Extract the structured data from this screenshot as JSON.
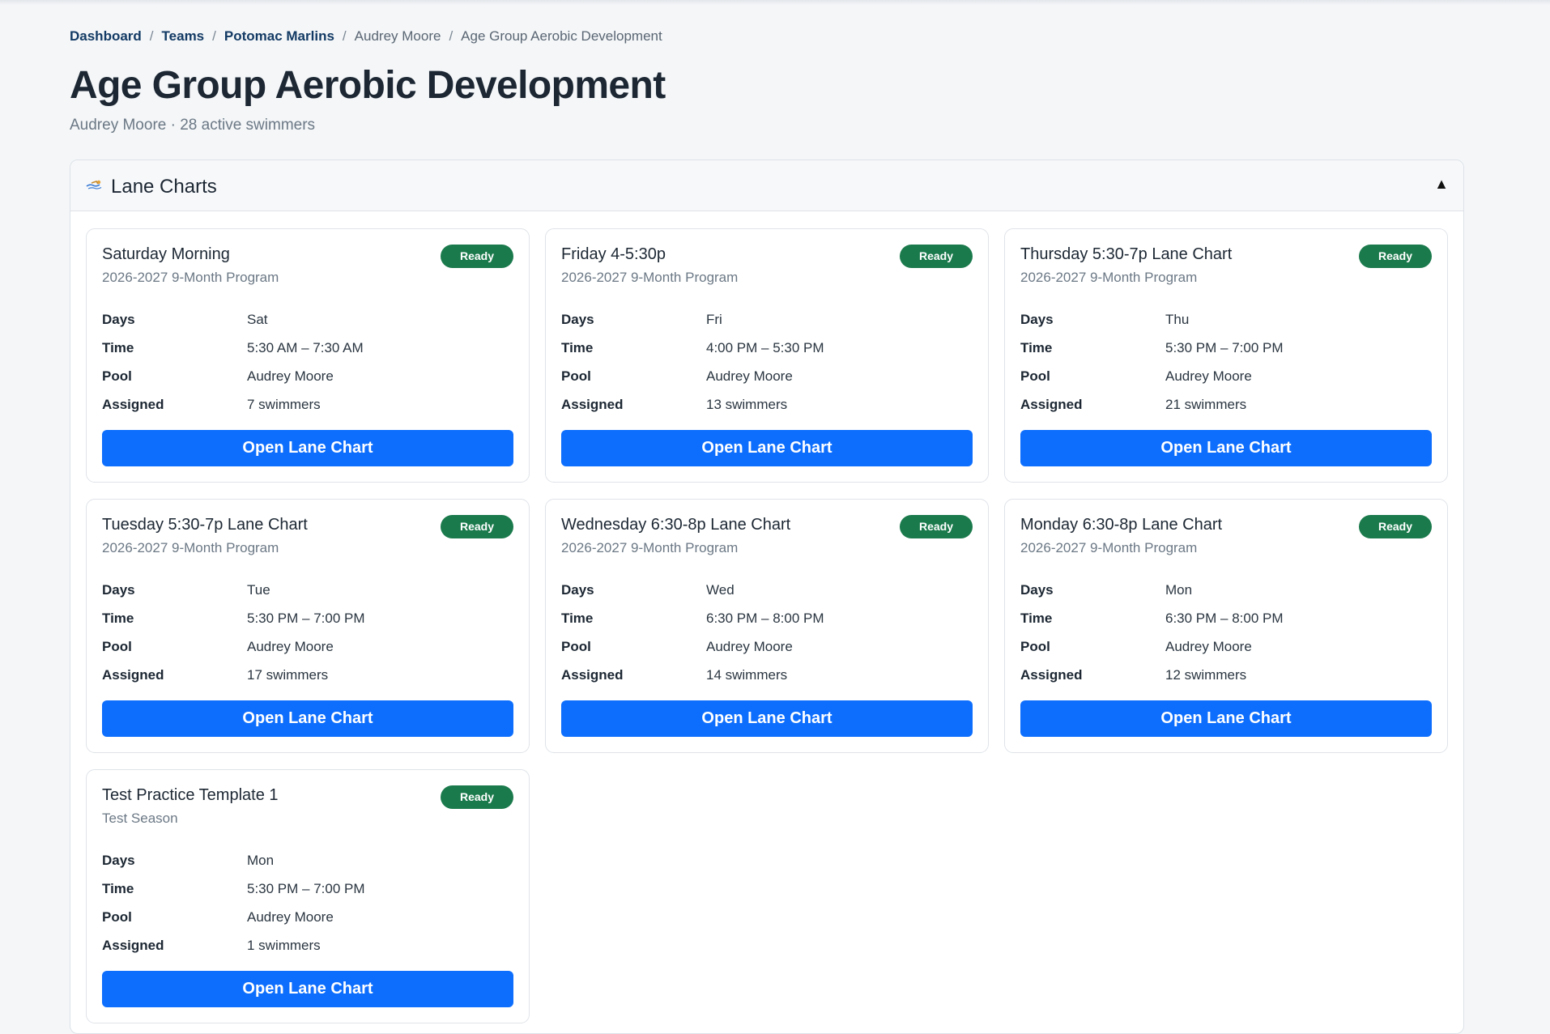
{
  "breadcrumb": {
    "items": [
      "Dashboard",
      "Teams",
      "Potomac Marlins",
      "Audrey Moore",
      "Age Group Aerobic Development"
    ],
    "separator": "/"
  },
  "page": {
    "title": "Age Group Aerobic Development",
    "subtitle": "Audrey Moore · 28 active swimmers"
  },
  "panel": {
    "title": "Lane Charts",
    "toggle": "▲"
  },
  "labels": {
    "days": "Days",
    "time": "Time",
    "pool": "Pool",
    "assigned": "Assigned",
    "button": "Open Lane Chart"
  },
  "cards": [
    {
      "title": "Saturday Morning",
      "season": "2026-2027 9-Month Program",
      "status": "Ready",
      "days": "Sat",
      "time": "5:30 AM – 7:30 AM",
      "pool": "Audrey Moore",
      "assigned": "7 swimmers"
    },
    {
      "title": "Friday 4-5:30p",
      "season": "2026-2027 9-Month Program",
      "status": "Ready",
      "days": "Fri",
      "time": "4:00 PM – 5:30 PM",
      "pool": "Audrey Moore",
      "assigned": "13 swimmers"
    },
    {
      "title": "Thursday 5:30-7p Lane Chart",
      "season": "2026-2027 9-Month Program",
      "status": "Ready",
      "days": "Thu",
      "time": "5:30 PM – 7:00 PM",
      "pool": "Audrey Moore",
      "assigned": "21 swimmers"
    },
    {
      "title": "Tuesday 5:30-7p Lane Chart",
      "season": "2026-2027 9-Month Program",
      "status": "Ready",
      "days": "Tue",
      "time": "5:30 PM – 7:00 PM",
      "pool": "Audrey Moore",
      "assigned": "17 swimmers"
    },
    {
      "title": "Wednesday 6:30-8p Lane Chart",
      "season": "2026-2027 9-Month Program",
      "status": "Ready",
      "days": "Wed",
      "time": "6:30 PM – 8:00 PM",
      "pool": "Audrey Moore",
      "assigned": "14 swimmers"
    },
    {
      "title": "Monday 6:30-8p Lane Chart",
      "season": "2026-2027 9-Month Program",
      "status": "Ready",
      "days": "Mon",
      "time": "6:30 PM – 8:00 PM",
      "pool": "Audrey Moore",
      "assigned": "12 swimmers"
    },
    {
      "title": "Test Practice Template 1",
      "season": "Test Season",
      "status": "Ready",
      "days": "Mon",
      "time": "5:30 PM – 7:00 PM",
      "pool": "Audrey Moore",
      "assigned": "1 swimmers"
    }
  ],
  "colors": {
    "accent": "#0d6efd",
    "ready_badge": "#1a7a4c",
    "breadcrumb_link": "#133a64"
  },
  "icons": {
    "panel_icon": "swimmer-icon"
  }
}
